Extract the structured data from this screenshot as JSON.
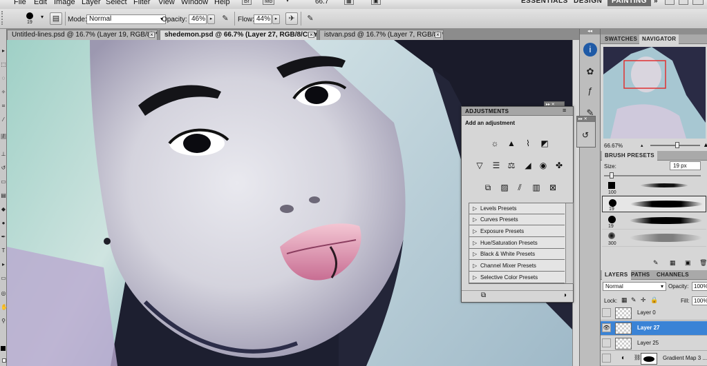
{
  "menu": {
    "items": [
      "File",
      "Edit",
      "Image",
      "Layer",
      "Select",
      "Filter",
      "View",
      "Window",
      "Help"
    ],
    "br_badge": "Br",
    "mb_badge": "Mb",
    "zoom": "66.7",
    "workspaces": [
      "ESSENTIALS",
      "DESIGN",
      "PAINTING"
    ],
    "more": "»"
  },
  "options": {
    "brush_size": "19",
    "mode_label": "Mode:",
    "mode_value": "Normal",
    "opacity_label": "Opacity:",
    "opacity_value": "46%",
    "flow_label": "Flow:",
    "flow_value": "44%"
  },
  "tabs": [
    {
      "label": "Untitled-lines.psd @ 16.7% (Layer 19, RGB/8) *"
    },
    {
      "label": "shedemon.psd @ 66.7% (Layer 27, RGB/8/CMYK)"
    },
    {
      "label": "istvan.psd @ 16.7% (Layer 7, RGB/8) *"
    }
  ],
  "navigator": {
    "tabs": [
      "SWATCHES",
      "NAVIGATOR"
    ],
    "zoom": "66.67%"
  },
  "brush_presets": {
    "title": "BRUSH PRESETS",
    "size_label": "Size:",
    "size_value": "19 px",
    "sizes": [
      "100",
      "19",
      "19",
      "300"
    ]
  },
  "layers": {
    "tabs": [
      "LAYERS",
      "PATHS",
      "CHANNELS"
    ],
    "blend": "Normal",
    "opacity_label": "Opacity:",
    "opacity_value": "100%",
    "lock_label": "Lock:",
    "fill_label": "Fill:",
    "fill_value": "100%",
    "items": [
      {
        "name": "Layer 0"
      },
      {
        "name": "Layer 27"
      },
      {
        "name": "Layer 25"
      },
      {
        "name": "Gradient Map 3 ..."
      }
    ]
  },
  "adjustments": {
    "title": "ADJUSTMENTS",
    "subtitle": "Add an adjustment",
    "presets": [
      "Levels Presets",
      "Curves Presets",
      "Exposure Presets",
      "Hue/Saturation Presets",
      "Black & White Presets",
      "Channel Mixer Presets",
      "Selective Color Presets"
    ]
  }
}
